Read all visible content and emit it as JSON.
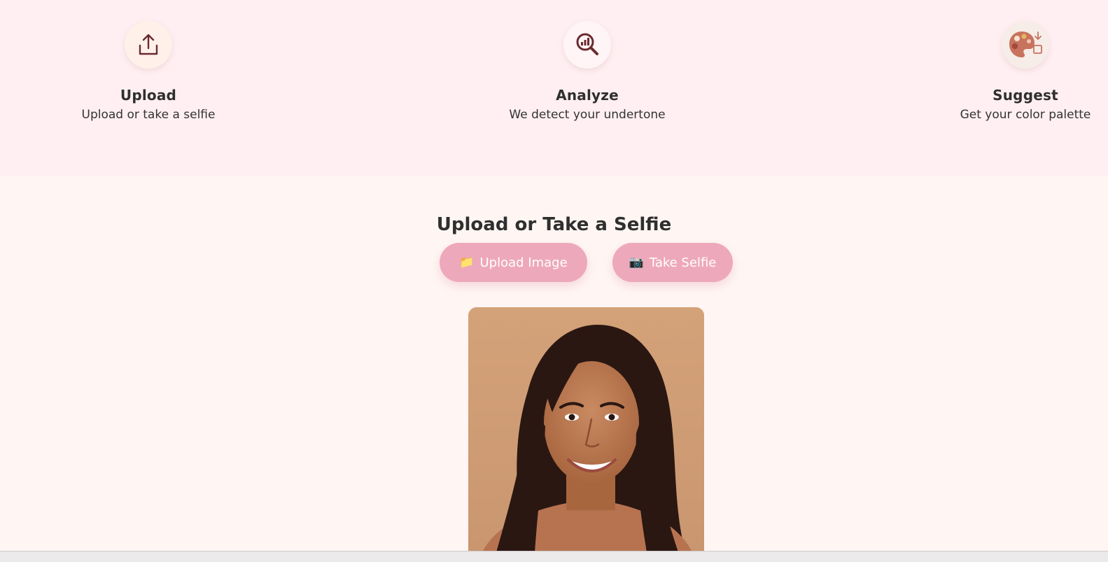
{
  "steps": [
    {
      "title": "Upload",
      "desc": "Upload or take a selfie",
      "icon": "upload-icon"
    },
    {
      "title": "Analyze",
      "desc": "We detect your undertone",
      "icon": "analyze-magnifier-icon"
    },
    {
      "title": "Suggest",
      "desc": "Get your color palette",
      "icon": "palette-icon"
    }
  ],
  "upload": {
    "title": "Upload or Take a Selfie",
    "upload_button": {
      "emoji": "📁",
      "label": "Upload Image"
    },
    "selfie_button": {
      "emoji": "📷",
      "label": "Take Selfie"
    },
    "preview_image": "selfie-preview"
  },
  "colors": {
    "band_bg": "#ffeff2",
    "page_bg": "#fff6f3",
    "button_bg": "#eea8bb",
    "icon_stroke": "#6b2a2e"
  }
}
